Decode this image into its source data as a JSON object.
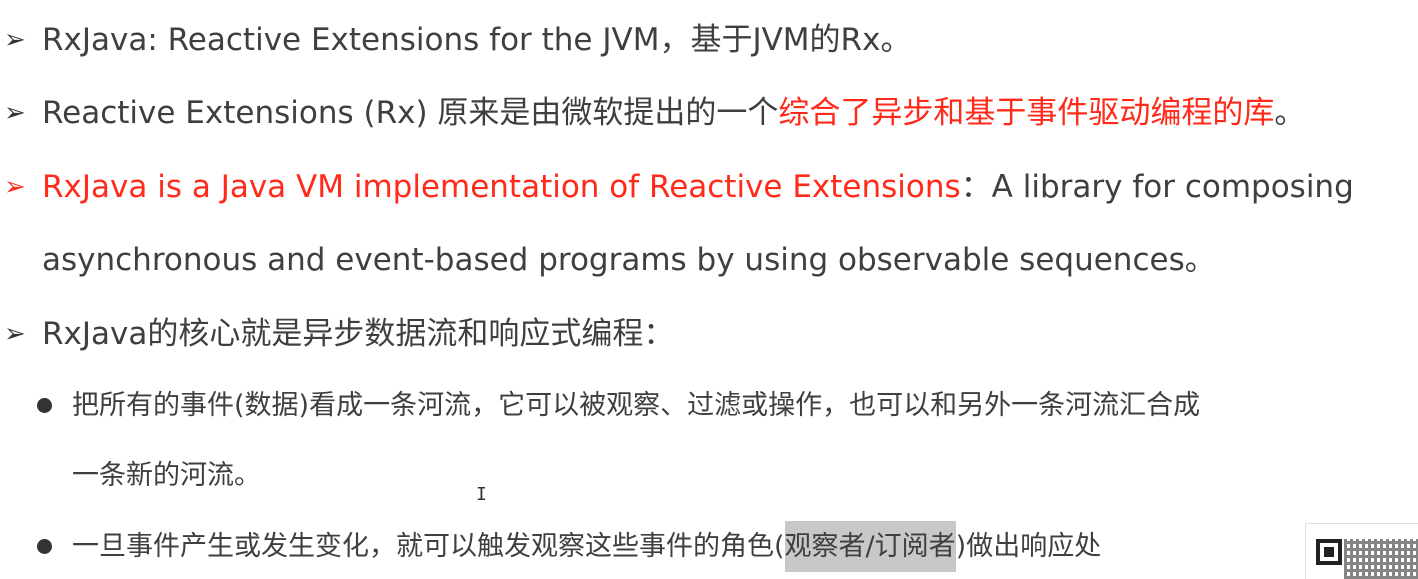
{
  "colors": {
    "text": "#3f3f3f",
    "accent_red": "#ff2a1a",
    "highlight": "#c8c8c8"
  },
  "icons": {
    "bullet_arrow": "arrow-bullet-icon",
    "bullet_dot": "dot-bullet-icon",
    "qr": "qr-code-icon",
    "cursor": "text-cursor-icon"
  },
  "lines": [
    {
      "text": "RxJava: Reactive Extensions for the JVM，基于JVM的Rx。"
    },
    {
      "text_a": "Reactive Extensions (Rx) 原来是由微软提出的一个",
      "text_red": "综合了异步和基于事件驱动编程的库",
      "text_b": "。"
    },
    {
      "text_red": "RxJava is a Java VM implementation of Reactive Extensions",
      "text_b": "：A library for composing"
    },
    {
      "text": "asynchronous and event-based programs by using observable sequences。"
    },
    {
      "text": "RxJava的核心就是异步数据流和响应式编程："
    }
  ],
  "sub_items": [
    {
      "text": "把所有的事件(数据)看成一条河流，它可以被观察、过滤或操作，也可以和另外一条河流汇合成",
      "cont": "一条新的河流。"
    },
    {
      "text_a": "一旦事件产生或发生变化，就可以触发观察这些事件的角色(",
      "text_hl": "观察者/订阅者",
      "text_b": ")做出响应处"
    }
  ]
}
